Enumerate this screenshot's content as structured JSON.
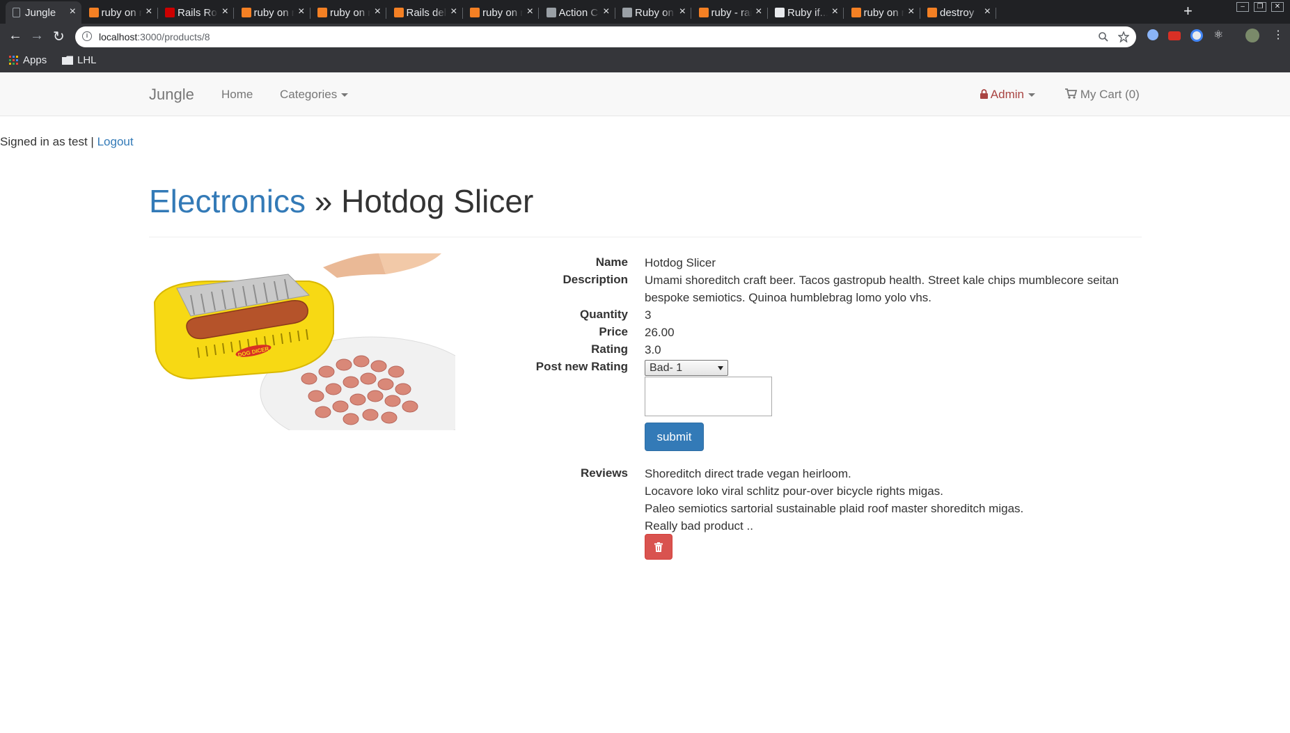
{
  "browser": {
    "tabs": [
      {
        "title": "Jungle",
        "active": true
      },
      {
        "title": "ruby on rails",
        "active": false
      },
      {
        "title": "Rails Routing",
        "active": false
      },
      {
        "title": "ruby on rails",
        "active": false
      },
      {
        "title": "ruby on rails",
        "active": false
      },
      {
        "title": "Rails delete",
        "active": false
      },
      {
        "title": "ruby on rails",
        "active": false
      },
      {
        "title": "Action Controller",
        "active": false
      },
      {
        "title": "Ruby on Rails",
        "active": false
      },
      {
        "title": "ruby - rails",
        "active": false
      },
      {
        "title": "Ruby if...else",
        "active": false
      },
      {
        "title": "ruby on rails",
        "active": false
      },
      {
        "title": "destroy",
        "active": false
      }
    ],
    "url_host": "localhost",
    "url_path": ":3000/products/8",
    "bookmarks": {
      "apps": "Apps",
      "folder": "LHL"
    }
  },
  "navbar": {
    "brand": "Jungle",
    "home": "Home",
    "categories": "Categories",
    "admin": "Admin",
    "cart": "My Cart (0)"
  },
  "session": {
    "signed_in_text": "Signed in as test |",
    "logout": "Logout"
  },
  "product": {
    "category": "Electronics",
    "separator": "»",
    "name": "Hotdog Slicer",
    "labels": {
      "name": "Name",
      "description": "Description",
      "quantity": "Quantity",
      "price": "Price",
      "rating": "Rating",
      "post_rating": "Post new Rating",
      "reviews": "Reviews"
    },
    "description": "Umami shoreditch craft beer. Tacos gastropub health. Street kale chips mumblecore seitan bespoke semiotics. Quinoa humblebrag lomo yolo vhs.",
    "quantity": "3",
    "price": "26.00",
    "rating": "3.0",
    "rating_selected": "Bad- 1",
    "submit": "submit",
    "reviews": [
      "Shoreditch direct trade vegan heirloom.",
      "Locavore loko viral schlitz pour-over bicycle rights migas.",
      "Paleo semiotics sartorial sustainable plaid roof master shoreditch migas.",
      "Really bad product .."
    ],
    "image_label": "DOG DICER"
  },
  "colors": {
    "link": "#337ab7",
    "admin": "#a94442",
    "submit_bg": "#337ab7",
    "delete_bg": "#d9534f"
  }
}
